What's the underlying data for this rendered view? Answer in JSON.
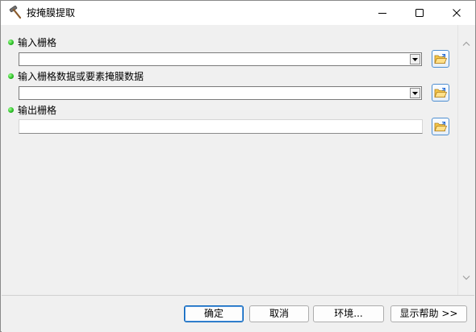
{
  "window": {
    "title": "按掩膜提取",
    "icon": "hammer-icon"
  },
  "params": [
    {
      "label": "输入栅格",
      "type": "combo",
      "value": ""
    },
    {
      "label": "输入栅格数据或要素掩膜数据",
      "type": "combo",
      "value": ""
    },
    {
      "label": "输出栅格",
      "type": "text",
      "value": ""
    }
  ],
  "buttons": {
    "ok": "确定",
    "cancel": "取消",
    "environments": "环境...",
    "help": "显示帮助 >>"
  },
  "colors": {
    "required_dot": "#2fc12a",
    "default_button_border": "#005fb8"
  }
}
